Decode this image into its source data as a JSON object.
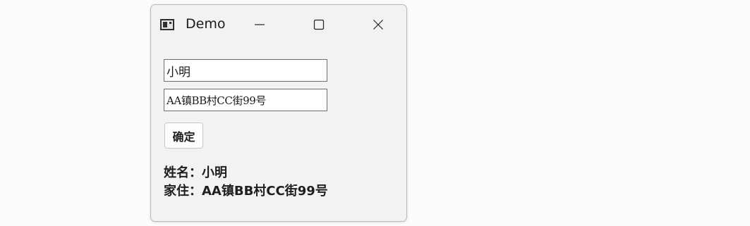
{
  "window": {
    "title": "Demo",
    "icon": "app-window-icon",
    "controls": {
      "minimize_icon": "minimize-icon",
      "maximize_icon": "maximize-icon",
      "close_icon": "close-icon"
    }
  },
  "form": {
    "name_value": "小明",
    "address_value": "AA镇BB村CC街99号",
    "confirm_label": "确定"
  },
  "output": {
    "name_line": "姓名：小明",
    "address_line": "家住：AA镇BB村CC街99号"
  },
  "colors": {
    "window_bg": "#f2f2f2",
    "window_border": "#b9b9b9",
    "input_border": "#6e6e6e",
    "text": "#1e1e1e"
  }
}
